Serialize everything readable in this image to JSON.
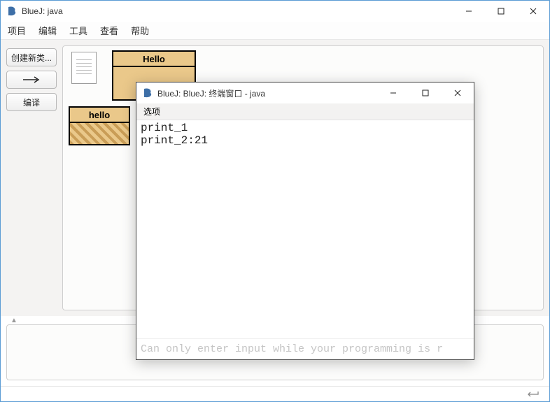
{
  "main": {
    "title": "BlueJ: java",
    "menu": {
      "project": "项目",
      "edit": "编辑",
      "tools": "工具",
      "view": "查看",
      "help": "帮助"
    },
    "buttons": {
      "new_class": "创建新类...",
      "compile": "编译"
    },
    "classes": {
      "hello_label": "Hello",
      "obj_label": "hello"
    },
    "collapse_glyph": "▲"
  },
  "terminal": {
    "title": "BlueJ: BlueJ: 终端窗口 - java",
    "menu": {
      "options": "选项"
    },
    "output": "print_1\nprint_2:21",
    "hint": "Can only enter input while your programming is r"
  }
}
